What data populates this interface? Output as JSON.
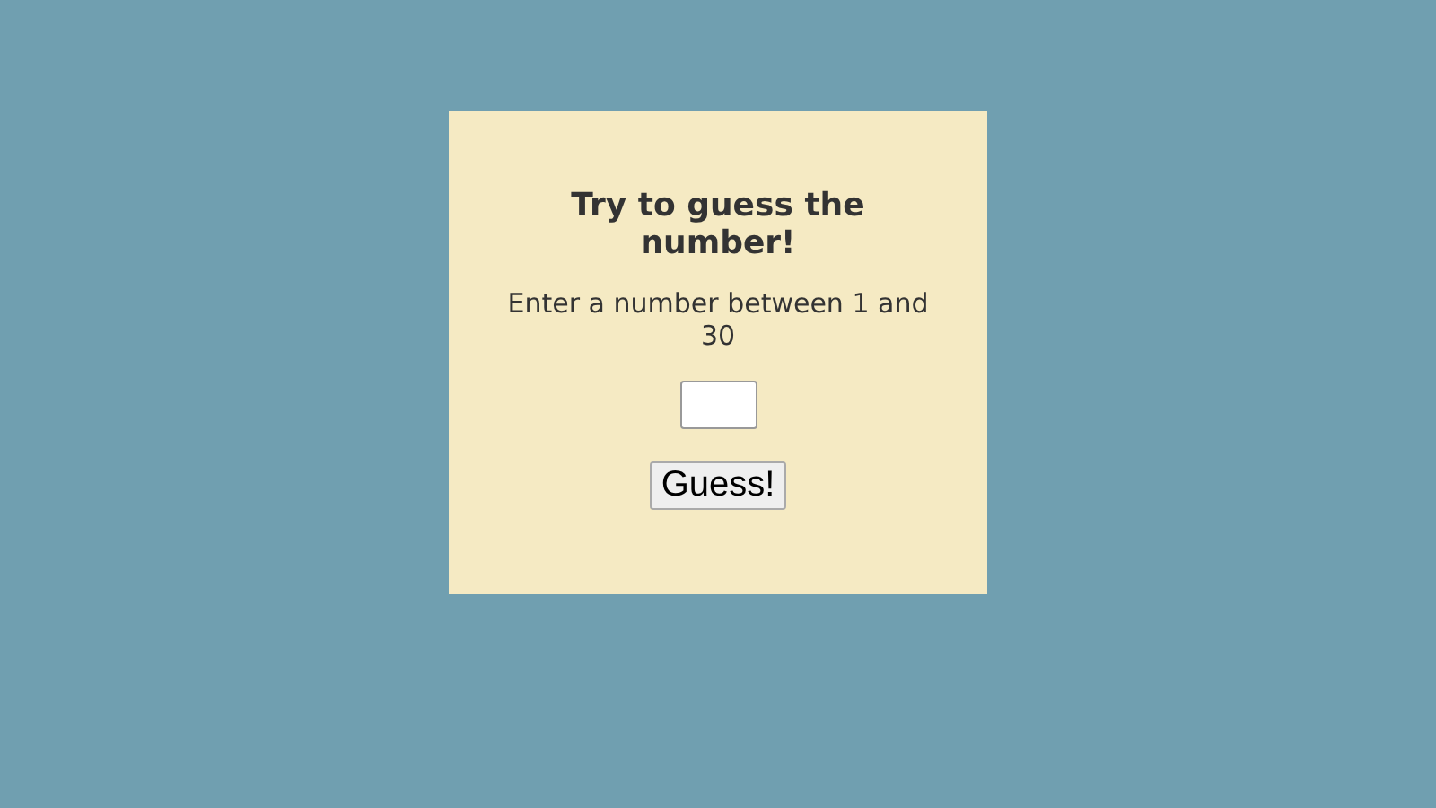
{
  "card": {
    "title": "Try to guess the number!",
    "instruction": "Enter a number between 1 and 30",
    "button": "Guess!"
  }
}
